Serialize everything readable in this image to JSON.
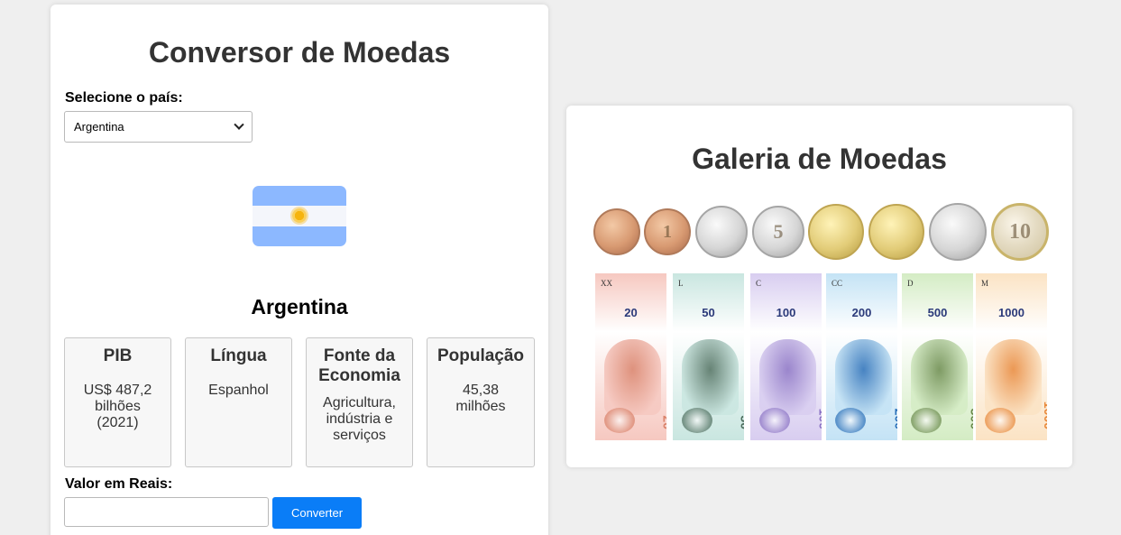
{
  "converter": {
    "title": "Conversor de Moedas",
    "country_label": "Selecione o país:",
    "country_selected": "Argentina",
    "country_name": "Argentina",
    "flag_icon": "argentina-flag-icon",
    "info": [
      {
        "heading": "PIB",
        "value": "US$ 487,2 bilhões (2021)"
      },
      {
        "heading": "Língua",
        "value": "Espanhol"
      },
      {
        "heading": "Fonte da Economia",
        "value": "Agricultura, indústria e serviços"
      },
      {
        "heading": "População",
        "value": "45,38 milhões"
      }
    ],
    "amount_label": "Valor em Reais:",
    "amount_value": "",
    "convert_label": "Converter"
  },
  "gallery": {
    "title": "Galeria de Moedas",
    "coins": [
      {
        "icon": "coin-icon",
        "metal": "copper",
        "mark": ""
      },
      {
        "icon": "coin-icon",
        "metal": "copper",
        "mark": "1"
      },
      {
        "icon": "coin-icon",
        "metal": "silver",
        "mark": ""
      },
      {
        "icon": "coin-icon",
        "metal": "silver",
        "mark": "5"
      },
      {
        "icon": "coin-icon",
        "metal": "gold",
        "mark": ""
      },
      {
        "icon": "coin-icon",
        "metal": "gold",
        "mark": ""
      },
      {
        "icon": "coin-icon",
        "metal": "silver",
        "mark": ""
      },
      {
        "icon": "coin-icon",
        "metal": "bimetal",
        "mark": "10"
      }
    ],
    "banknotes": [
      {
        "icon": "banknote-icon",
        "serial": "XX",
        "denomination": "20",
        "color": "#f6c8c0",
        "accent": "#d9826a"
      },
      {
        "icon": "banknote-icon",
        "serial": "L",
        "denomination": "50",
        "color": "#c9e6e0",
        "accent": "#4f6f5f"
      },
      {
        "icon": "banknote-icon",
        "serial": "C",
        "denomination": "100",
        "color": "#d8cdf0",
        "accent": "#8b73c4"
      },
      {
        "icon": "banknote-icon",
        "serial": "CC",
        "denomination": "200",
        "color": "#c4e3f5",
        "accent": "#2a6fb8"
      },
      {
        "icon": "banknote-icon",
        "serial": "D",
        "denomination": "500",
        "color": "#d4ecc4",
        "accent": "#6a8a4c"
      },
      {
        "icon": "banknote-icon",
        "serial": "M",
        "denomination": "1000",
        "color": "#fbe3c4",
        "accent": "#e8883a"
      }
    ]
  }
}
